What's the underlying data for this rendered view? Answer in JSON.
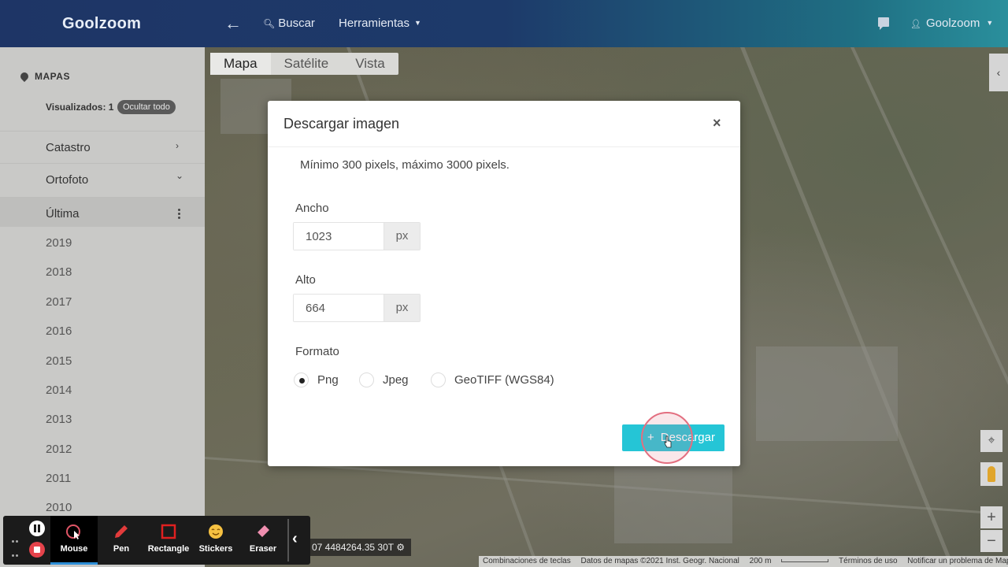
{
  "header": {
    "logo": "Goolzoom",
    "back_icon": "arrow-left-icon",
    "search_label": "Buscar",
    "tools_label": "Herramientas",
    "user_label": "Goolzoom"
  },
  "sidebar": {
    "heading": "MAPAS",
    "visualized": "Visualizados: 1",
    "hide_all": "Ocultar todo",
    "sections": [
      {
        "label": "Catastro",
        "chevron": "›"
      },
      {
        "label": "Ortofoto",
        "chevron": "⌄"
      }
    ],
    "selected_item": "Última",
    "years": [
      "2019",
      "2018",
      "2017",
      "2016",
      "2015",
      "2014",
      "2013",
      "2012",
      "2011",
      "2010"
    ]
  },
  "map": {
    "tabs": [
      "Mapa",
      "Satélite",
      "Vista"
    ],
    "active_tab": "Mapa",
    "coords": "07 4484264.35 30T",
    "attribution": [
      "Combinaciones de teclas",
      "Datos de mapas ©2021 Inst. Geogr. Nacional",
      "200 m",
      "Términos de uso",
      "Notificar un problema de Maps"
    ],
    "zoom_in": "+",
    "zoom_out": "−"
  },
  "modal": {
    "title": "Descargar imagen",
    "close": "×",
    "note": "Mínimo 300 pixels, máximo 3000 pixels.",
    "width_label": "Ancho",
    "width_value": "1023",
    "height_label": "Alto",
    "height_value": "664",
    "unit": "px",
    "format_label": "Formato",
    "formats": [
      "Png",
      "Jpeg",
      "GeoTIFF (WGS84)"
    ],
    "selected_format": "Png",
    "download_label": "Descargar",
    "download_icon": "+"
  },
  "recorder": {
    "tools": [
      "Mouse",
      "Pen",
      "Rectangle",
      "Stickers",
      "Eraser"
    ],
    "active_tool": "Mouse",
    "colors": {
      "pen": "#e23b3b",
      "rectangle": "#e02020",
      "eraser": "#f08fb0",
      "sticker": "#f6c141",
      "accent": "#2d8fd8"
    }
  }
}
